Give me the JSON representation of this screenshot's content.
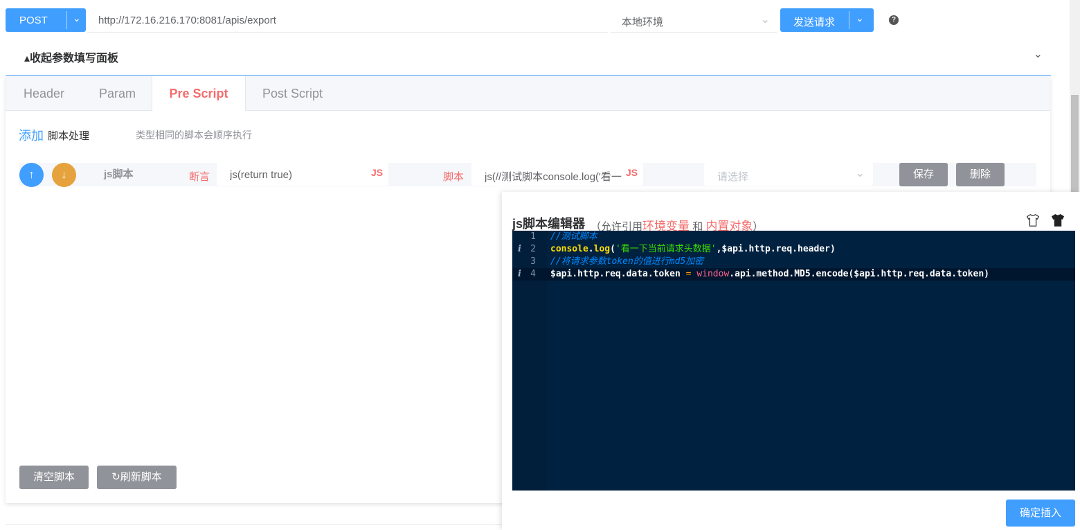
{
  "topbar": {
    "method": "POST",
    "url": "http://172.16.216.170:8081/apis/export",
    "env": "本地环境",
    "send_label": "发送请求",
    "help": "?"
  },
  "collapse": {
    "title": "▴收起参数填写面板"
  },
  "tabs": [
    {
      "label": "Header"
    },
    {
      "label": "Param"
    },
    {
      "label": "Pre Script",
      "active": true
    },
    {
      "label": "Post Script"
    }
  ],
  "script_panel": {
    "add_link": "添加",
    "add_label": "脚本处理",
    "hint": "类型相同的脚本会顺序执行",
    "row": {
      "up_icon": "↑",
      "down_icon": "↓",
      "name": "js脚本",
      "assert_label": "断言",
      "assert_value": "js(return true)",
      "js_mark": "JS",
      "script_label": "脚本",
      "script_value": "js(//测试脚本console.log('看一",
      "select_placeholder": "请选择",
      "save_label": "保存",
      "delete_label": "删除"
    },
    "clear_label": "清空脚本",
    "refresh_label": "刷新脚本"
  },
  "editor": {
    "title": "js脚本编辑器",
    "note_open": "（允许引用",
    "env_link": "环境变量",
    "and": "和",
    "builtin_link": "内置对象",
    "note_close": "）",
    "lines": [
      {
        "num": "1",
        "info": ""
      },
      {
        "num": "2",
        "info": "i"
      },
      {
        "num": "3",
        "info": ""
      },
      {
        "num": "4",
        "info": "i"
      }
    ],
    "code": {
      "l1": "//测试脚本",
      "l2a": "console",
      "l2b": ".",
      "l2c": "log",
      "l2d": "(",
      "l2e": "'看一下当前请求头数据'",
      "l2f": ",$api.http.req.header)",
      "l3": "//将请求参数token的值进行md5加密",
      "l4a": "$api.http.req.data.token ",
      "l4b": "=",
      "l4c": " ",
      "l4d": "window",
      "l4e": ".api.method.MD5.encode($api.http.req.data.token)"
    },
    "confirm_label": "确定插入"
  },
  "colors": {
    "primary": "#409eff",
    "danger": "#f56c6c",
    "warning": "#e6a23c",
    "editor_bg": "#002240"
  }
}
